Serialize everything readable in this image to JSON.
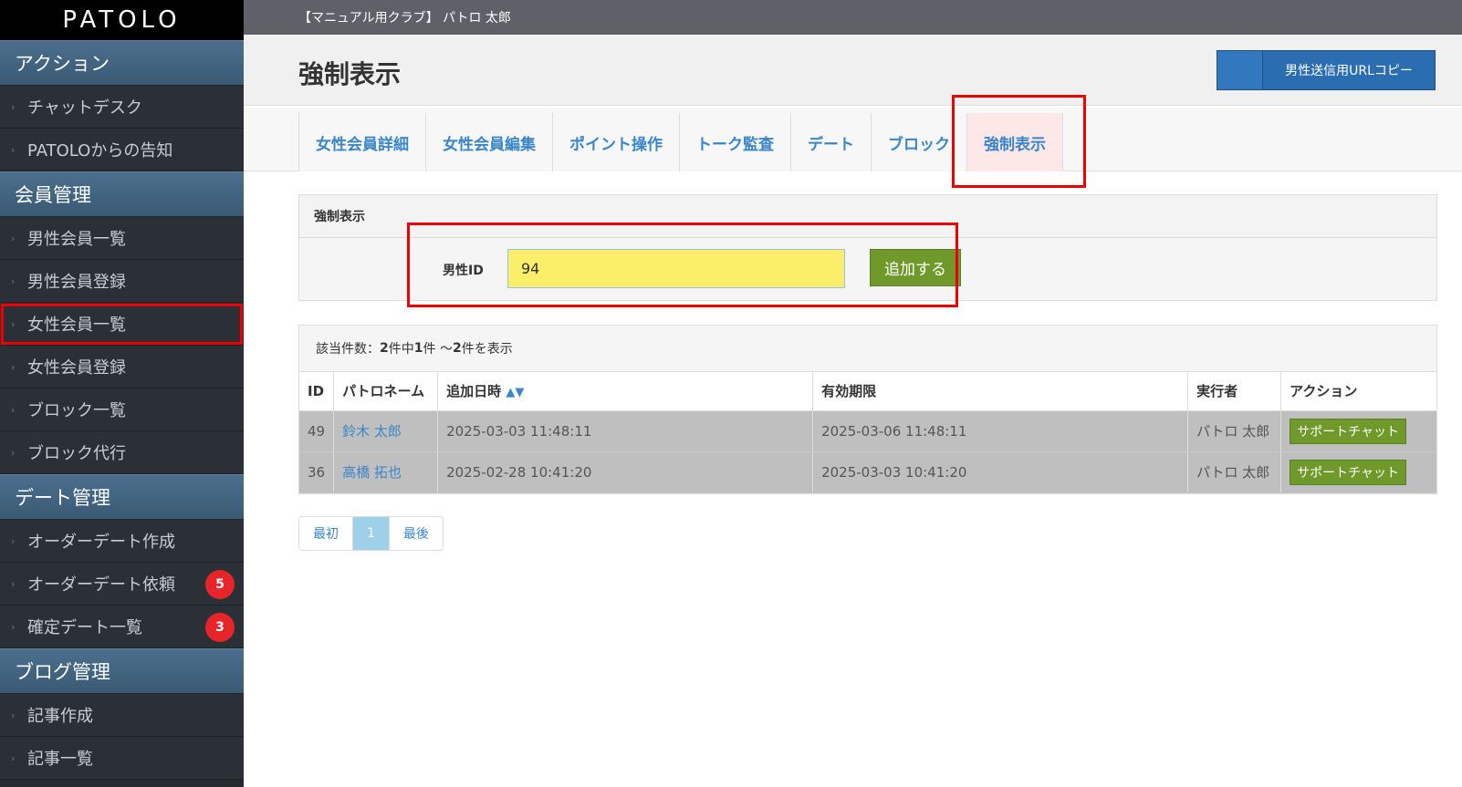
{
  "app": {
    "logo": "PATOLO",
    "topbar_text": "【マニュアル用クラブ】 パトロ 太郎"
  },
  "sidebar": {
    "sections": [
      {
        "title": "アクション",
        "items": [
          {
            "label": "チャットデスク"
          },
          {
            "label": "PATOLOからの告知"
          }
        ]
      },
      {
        "title": "会員管理",
        "items": [
          {
            "label": "男性会員一覧"
          },
          {
            "label": "男性会員登録"
          },
          {
            "label": "女性会員一覧"
          },
          {
            "label": "女性会員登録"
          },
          {
            "label": "ブロック一覧"
          },
          {
            "label": "ブロック代行"
          }
        ]
      },
      {
        "title": "デート管理",
        "items": [
          {
            "label": "オーダーデート作成"
          },
          {
            "label": "オーダーデート依頼",
            "badge": "5"
          },
          {
            "label": "確定デート一覧",
            "badge": "3"
          }
        ]
      },
      {
        "title": "ブログ管理",
        "items": [
          {
            "label": "記事作成"
          },
          {
            "label": "記事一覧"
          }
        ]
      }
    ]
  },
  "header": {
    "title": "強制表示",
    "copy_button": "男性送信用URLコピー"
  },
  "tabs": [
    {
      "label": "女性会員詳細"
    },
    {
      "label": "女性会員編集"
    },
    {
      "label": "ポイント操作"
    },
    {
      "label": "トーク監査"
    },
    {
      "label": "デート"
    },
    {
      "label": "ブロック"
    },
    {
      "label": "強制表示",
      "active": true
    }
  ],
  "form": {
    "panel_title": "強制表示",
    "male_id_label": "男性ID",
    "male_id_value": "94",
    "add_button": "追加する"
  },
  "results": {
    "count_prefix": "該当件数：",
    "total": "2",
    "count_mid1": "件中 ",
    "from": "1",
    "count_mid2": "件 ～ ",
    "to": "2",
    "count_suffix": "件を表示",
    "columns": [
      "ID",
      "パトロネーム",
      "追加日時",
      "有効期限",
      "実行者",
      "アクション"
    ],
    "sort_indicator": "▲▼",
    "rows": [
      {
        "id": "49",
        "name": "鈴木 太郎",
        "added": "2025-03-03 11:48:11",
        "expires": "2025-03-06 11:48:11",
        "executor": "パトロ 太郎",
        "action": "サポートチャット"
      },
      {
        "id": "36",
        "name": "高橋 拓也",
        "added": "2025-02-28 10:41:20",
        "expires": "2025-03-03 10:41:20",
        "executor": "パトロ 太郎",
        "action": "サポートチャット"
      }
    ]
  },
  "pagination": {
    "first": "最初",
    "current": "1",
    "last": "最後"
  },
  "colors": {
    "accent_link": "#3a86c8",
    "button_green": "#6f9a2b",
    "highlight_red": "#e00000",
    "input_yellow": "#fbef6a"
  }
}
